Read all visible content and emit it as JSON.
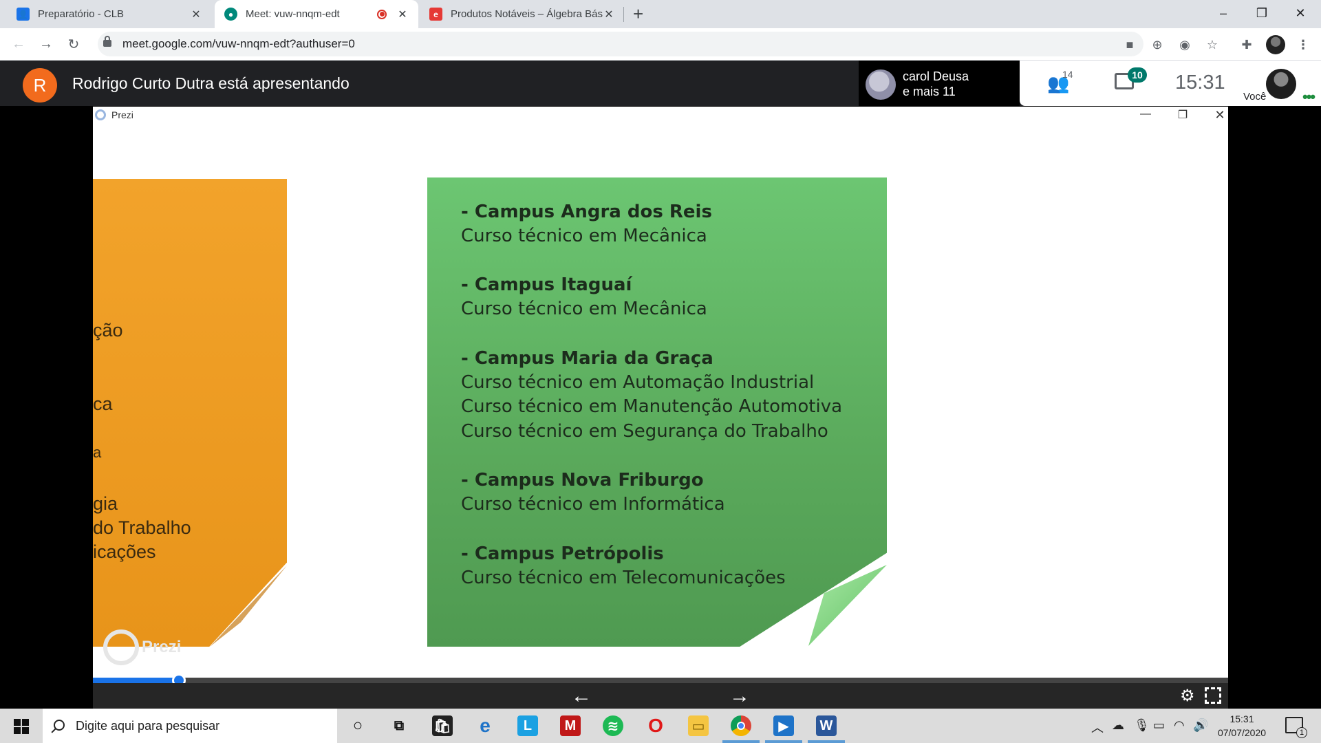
{
  "browser": {
    "tabs": [
      {
        "title": "Preparatório - CLB",
        "fav_color": "#1a73e8"
      },
      {
        "title": "Meet: vuw-nnqm-edt",
        "fav_color": "#00897b"
      },
      {
        "title": "Produtos Notáveis – Álgebra Básica",
        "fav_color": "#e53935"
      }
    ],
    "new_tab": "+",
    "url": "meet.google.com/vuw-nnqm-edt?authuser=0",
    "win_min": "–",
    "win_max": "❐",
    "win_close": "✕"
  },
  "meet": {
    "presenter_initial": "R",
    "presenter_text": "Rodrigo Curto Dutra está apresentando",
    "participant_name": "carol Deusa",
    "participant_more": "e mais 11",
    "people_count": "14",
    "chat_badge": "10",
    "time": "15:31",
    "you_label": "Você"
  },
  "prezi": {
    "window_title": "Prezi",
    "watermark": "Prezi",
    "orange_fragments": [
      "ção",
      "ca",
      "a",
      "gia",
      "do Trabalho",
      "icações"
    ],
    "campuses": [
      {
        "name": "- Campus Angra dos Reis",
        "courses": [
          "Curso técnico em Mecânica"
        ]
      },
      {
        "name": "- Campus Itaguaí",
        "courses": [
          "Curso técnico em Mecânica"
        ]
      },
      {
        "name": "- Campus Maria da Graça",
        "courses": [
          "Curso técnico em Automação Industrial",
          "Curso técnico em Manutenção Automotiva",
          "Curso técnico em Segurança do Trabalho"
        ]
      },
      {
        "name": "- Campus Nova Friburgo",
        "courses": [
          "Curso técnico em Informática"
        ]
      },
      {
        "name": "- Campus Petrópolis",
        "courses": [
          "Curso técnico em Telecomunicações"
        ]
      }
    ],
    "progress_fraction": 0.076,
    "prev_arrow": "←",
    "next_arrow": "→"
  },
  "taskbar": {
    "search_placeholder": "Digite aqui para pesquisar",
    "clock_time": "15:31",
    "clock_date": "07/07/2020",
    "notif_count": "1"
  }
}
